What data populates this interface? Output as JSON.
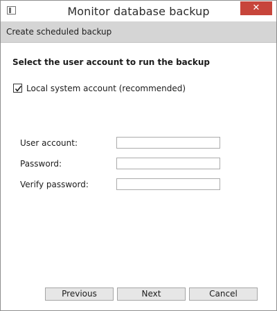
{
  "window": {
    "title": "Monitor database backup",
    "close_label": "✕"
  },
  "header": {
    "text": "Create scheduled backup"
  },
  "main": {
    "section_title": "Select the user account to run the backup",
    "local_system_checkbox": {
      "label": "Local system account (recommended)",
      "checked": true
    },
    "fields": [
      {
        "label": "User account:",
        "value": "",
        "placeholder": ""
      },
      {
        "label": "Password:",
        "value": "",
        "placeholder": ""
      },
      {
        "label": "Verify password:",
        "value": "",
        "placeholder": ""
      }
    ]
  },
  "footer": {
    "previous_label": "Previous",
    "next_label": "Next",
    "cancel_label": "Cancel"
  },
  "colors": {
    "close_button": "#c7453b",
    "header_strip": "#d5d5d5",
    "button_face": "#e6e6e6"
  }
}
